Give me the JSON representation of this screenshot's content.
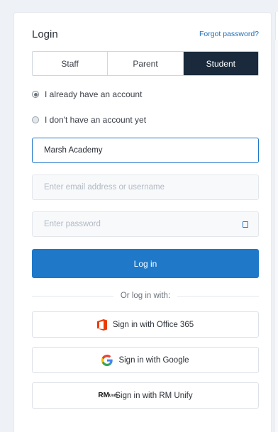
{
  "header": {
    "title": "Login",
    "forgot_password": "Forgot password?"
  },
  "tabs": [
    {
      "label": "Staff",
      "active": false
    },
    {
      "label": "Parent",
      "active": false
    },
    {
      "label": "Student",
      "active": true
    }
  ],
  "account_options": [
    {
      "label": "I already have an account",
      "checked": true
    },
    {
      "label": "I don't have an account yet",
      "checked": false
    }
  ],
  "form": {
    "school_value": "Marsh Academy",
    "email_placeholder": "Enter email address or username",
    "password_placeholder": "Enter password",
    "login_label": "Log in"
  },
  "divider_text": "Or log in with:",
  "sso": {
    "office365": "Sign in with Office 365",
    "google": "Sign in with Google",
    "rm_unify": "Sign in with RM Unify",
    "rm_logo_main": "RM",
    "rm_logo_sub": "Unify"
  },
  "colors": {
    "accent": "#1f78c8",
    "active_tab": "#1a2a3c",
    "office_orange": "#eb3c00",
    "google_blue": "#4285f4",
    "google_red": "#ea4335",
    "google_yellow": "#fbbc05",
    "google_green": "#34a853"
  }
}
